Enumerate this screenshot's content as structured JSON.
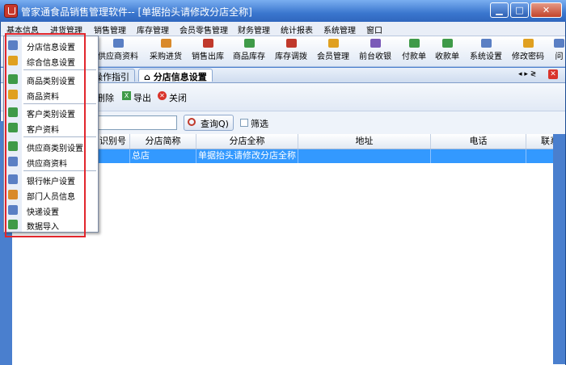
{
  "window": {
    "title": "管家通食品销售管理软件-- [单据抬头请修改分店全称]",
    "min": "▁",
    "max": "□",
    "close": "✕"
  },
  "menubar": {
    "items": [
      "基本信息",
      "进货管理",
      "销售管理",
      "库存管理",
      "会员零售管理",
      "财务管理",
      "统计报表",
      "系统管理",
      "窗口"
    ]
  },
  "toolbar": {
    "items": [
      "供应商资料",
      "采购进货",
      "销售出库",
      "商品库存",
      "库存调拨",
      "会员管理",
      "前台收银",
      "付款单",
      "收款单",
      "系统设置",
      "修改密码",
      "问"
    ],
    "icon_colors": [
      "#5a7fc4",
      "#d98a2b",
      "#c0392b",
      "#3f9a48",
      "#c0392b",
      "#e0a020",
      "#7a5ab8",
      "#3f9a48",
      "#3f9a48",
      "#5a7fc4",
      "#e0a020",
      "#5a7fc4"
    ]
  },
  "tabs": {
    "guide": "操作指引",
    "active": "分店信息设置",
    "nav": "◂ ▸ ≷"
  },
  "actions": {
    "delete": "删除",
    "export": "导出",
    "close": "关闭"
  },
  "search": {
    "value": "",
    "query_label": "查询Q)",
    "filter_label": "筛选"
  },
  "grid": {
    "columns": [
      "识别号",
      "分店简称",
      "分店全称",
      "地址",
      "电话",
      "联系"
    ],
    "row": [
      "",
      "总店",
      "单据抬头请修改分店全称",
      "",
      "",
      ""
    ]
  },
  "dropdown": {
    "items": [
      {
        "label": "分店信息设置",
        "icon": "branch-icon",
        "color": "#5a7fc4"
      },
      {
        "label": "综合信息设置",
        "icon": "settings-icon",
        "color": "#e0a020"
      },
      {
        "label": "商品类别设置",
        "icon": "category-icon",
        "color": "#3f9a48"
      },
      {
        "label": "商品资料",
        "icon": "product-icon",
        "color": "#e0a020"
      },
      {
        "label": "客户类别设置",
        "icon": "category-icon",
        "color": "#3f9a48"
      },
      {
        "label": "客户资料",
        "icon": "customer-icon",
        "color": "#3f9a48"
      },
      {
        "label": "供应商类别设置",
        "icon": "category-icon",
        "color": "#3f9a48"
      },
      {
        "label": "供应商资料",
        "icon": "supplier-icon",
        "color": "#5a7fc4"
      },
      {
        "label": "银行帐户设置",
        "icon": "bank-icon",
        "color": "#5a7fc4"
      },
      {
        "label": "部门人员信息",
        "icon": "staff-icon",
        "color": "#d98a2b"
      },
      {
        "label": "快递设置",
        "icon": "express-icon",
        "color": "#5a7fc4"
      },
      {
        "label": "数据导入",
        "icon": "import-icon",
        "color": "#3f9a48"
      }
    ]
  },
  "colors": {
    "highlight": "#e2262c",
    "selection": "#3399ff",
    "frame": "#4a7fce"
  }
}
